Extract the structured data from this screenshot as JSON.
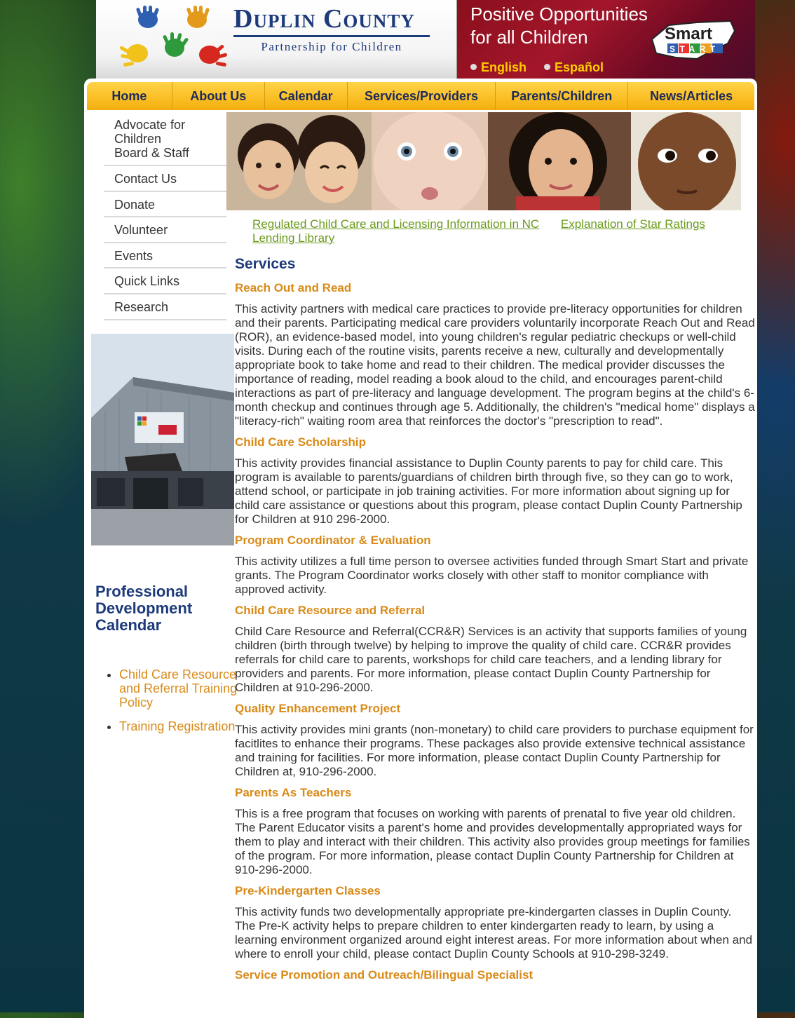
{
  "header": {
    "org_name": "Duplin County",
    "org_sub": "Partnership for Children",
    "tagline_line1": "Positive Opportunities",
    "tagline_line2": "for all Children",
    "smart_label": "Smart",
    "start_label": "START",
    "lang_english": "English",
    "lang_spanish": "Español"
  },
  "nav": {
    "items": [
      {
        "label": "Home"
      },
      {
        "label": "About Us"
      },
      {
        "label": "Calendar"
      },
      {
        "label": "Services/Providers"
      },
      {
        "label": "Parents/Children"
      },
      {
        "label": "News/Articles"
      }
    ]
  },
  "sidebar": {
    "items": [
      {
        "label": "Advocate for Children"
      },
      {
        "label": "Board & Staff"
      },
      {
        "label": "Contact Us"
      },
      {
        "label": "Donate"
      },
      {
        "label": "Volunteer"
      },
      {
        "label": "Events"
      },
      {
        "label": "Quick Links"
      },
      {
        "label": "Research"
      }
    ],
    "pd_title": "Professional Development Calendar",
    "pd_links": [
      {
        "label": "Child Care Resource and Referral Training Policy"
      },
      {
        "label": "Training Registration"
      }
    ]
  },
  "links": {
    "regulated": "Regulated Child Care and Licensing Information in NC",
    "star": "Explanation of Star Ratings",
    "lending": "Lending Library"
  },
  "content": {
    "title": "Services",
    "sections": [
      {
        "heading": "Reach Out and Read",
        "body": "This activity partners with medical care practices to provide pre-literacy opportunities for children and their parents. Participating medical care providers voluntarily incorporate Reach Out and Read (ROR), an evidence-based model, into young children's regular pediatric checkups or well-child visits. During each of the routine visits, parents receive a new, culturally and developmentally appropriate book to take home and read to their children. The medical provider discusses the importance of reading, model reading a book aloud to the child, and encourages parent-child interactions as part of pre-literacy and language development. The program begins at the child's 6-month checkup and continues through age 5. Additionally, the children's \"medical home\" displays a \"literacy-rich\" waiting room area that reinforces the doctor's \"prescription to read\"."
      },
      {
        "heading": "Child Care Scholarship",
        "body": "This activity provides financial assistance to Duplin County parents to pay for child care. This program is available to parents/guardians of children birth through five, so they can go to work, attend school, or participate in job training activities. For more information about signing up for child care assistance or questions about this program, please contact Duplin County Partnership for Children at 910 296-2000."
      },
      {
        "heading": "Program Coordinator & Evaluation",
        "body": "This activity utilizes a full time person to oversee activities funded through Smart Start and private grants. The Program Coordinator works closely with other staff to monitor compliance with approved activity."
      },
      {
        "heading": "Child Care Resource and Referral",
        "body": "Child Care Resource and Referral(CCR&R) Services is an activity that supports families of young children (birth through twelve) by helping to improve the quality of child care. CCR&R provides referrals for child care to parents, workshops for child care teachers, and a lending library for providers and parents. For more information, please contact Duplin County Partnership for Children at 910-296-2000."
      },
      {
        "heading": "Quality Enhancement Project",
        "body": "This activity provides mini grants (non-monetary) to child care providers to purchase equipment for facitlites to enhance their programs. These packages also provide extensive technical assistance and training for facilities. For more information, please contact Duplin County Partnership for Children at, 910-296-2000."
      },
      {
        "heading": "Parents As Teachers",
        "body": "This is a free program that focuses on working with parents of prenatal to five year old children. The Parent Educator visits a parent's home and provides developmentally appropriated ways for them to play and interact with their children. This activity also provides group meetings for families of the program. For more information, please contact Duplin County Partnership for Children at 910-296-2000."
      },
      {
        "heading": "Pre-Kindergarten Classes",
        "body": "This activity funds two developmentally appropriate pre-kindergarten classes in Duplin County.  The Pre-K activity helps to prepare children to enter kindergarten ready to learn, by using a learning environment organized around eight interest areas.  For more information about when and where to enroll your child, please contact Duplin County Schools at 910-298-3249."
      },
      {
        "heading": "Service Promotion and Outreach/Bilingual Specialist",
        "body": ""
      }
    ]
  },
  "colors": {
    "nav_bg": "#fbbf26",
    "heading_blue": "#1d3a7a",
    "section_orange": "#d98a18",
    "link_green": "#6a9a1a",
    "lang_yellow": "#ffcc00"
  },
  "icons": [
    "painted-hands-logo-icon",
    "smart-start-logo-icon",
    "radio-dot-icon"
  ]
}
